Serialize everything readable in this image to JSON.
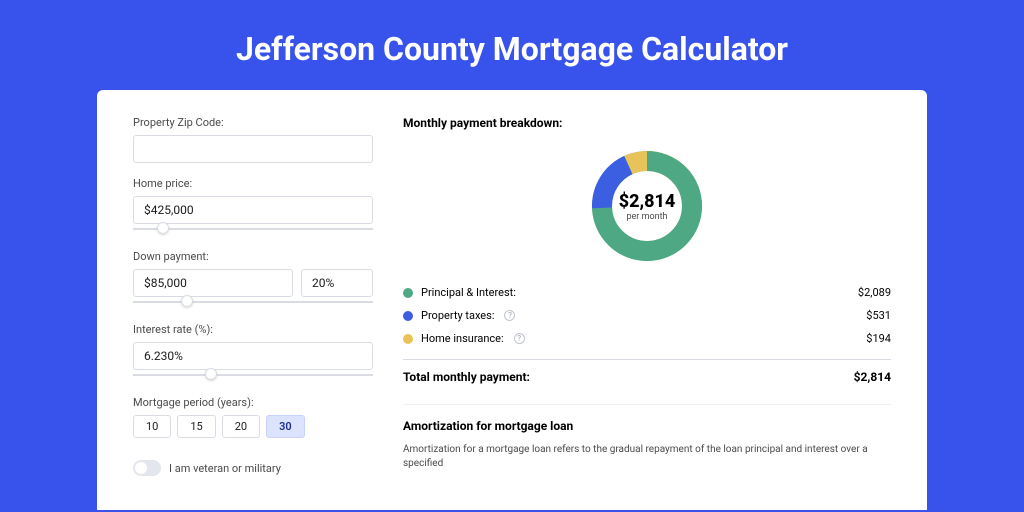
{
  "title": "Jefferson County Mortgage Calculator",
  "form": {
    "zip_label": "Property Zip Code:",
    "zip_value": "",
    "home_price_label": "Home price:",
    "home_price_value": "$425,000",
    "down_payment_label": "Down payment:",
    "down_payment_value": "$85,000",
    "down_payment_pct": "20%",
    "interest_label": "Interest rate (%):",
    "interest_value": "6.230%",
    "period_label": "Mortgage period (years):",
    "periods": [
      "10",
      "15",
      "20",
      "30"
    ],
    "period_active_index": 3,
    "veteran_label": "I am veteran or military"
  },
  "breakdown": {
    "title": "Monthly payment breakdown:",
    "center_amount": "$2,814",
    "center_sub": "per month",
    "items": [
      {
        "label": "Principal & Interest:",
        "value": "$2,089",
        "color": "g"
      },
      {
        "label": "Property taxes:",
        "value": "$531",
        "color": "b",
        "help": true
      },
      {
        "label": "Home insurance:",
        "value": "$194",
        "color": "y",
        "help": true
      }
    ],
    "total_label": "Total monthly payment:",
    "total_value": "$2,814"
  },
  "amort": {
    "title": "Amortization for mortgage loan",
    "body": "Amortization for a mortgage loan refers to the gradual repayment of the loan principal and interest over a specified"
  },
  "chart_data": {
    "type": "pie",
    "title": "Monthly payment breakdown",
    "series": [
      {
        "name": "Principal & Interest",
        "value": 2089,
        "color": "#4fa884"
      },
      {
        "name": "Property taxes",
        "value": 531,
        "color": "#3b5fe0"
      },
      {
        "name": "Home insurance",
        "value": 194,
        "color": "#e8c35a"
      }
    ],
    "total": 2814,
    "unit": "USD/month"
  }
}
